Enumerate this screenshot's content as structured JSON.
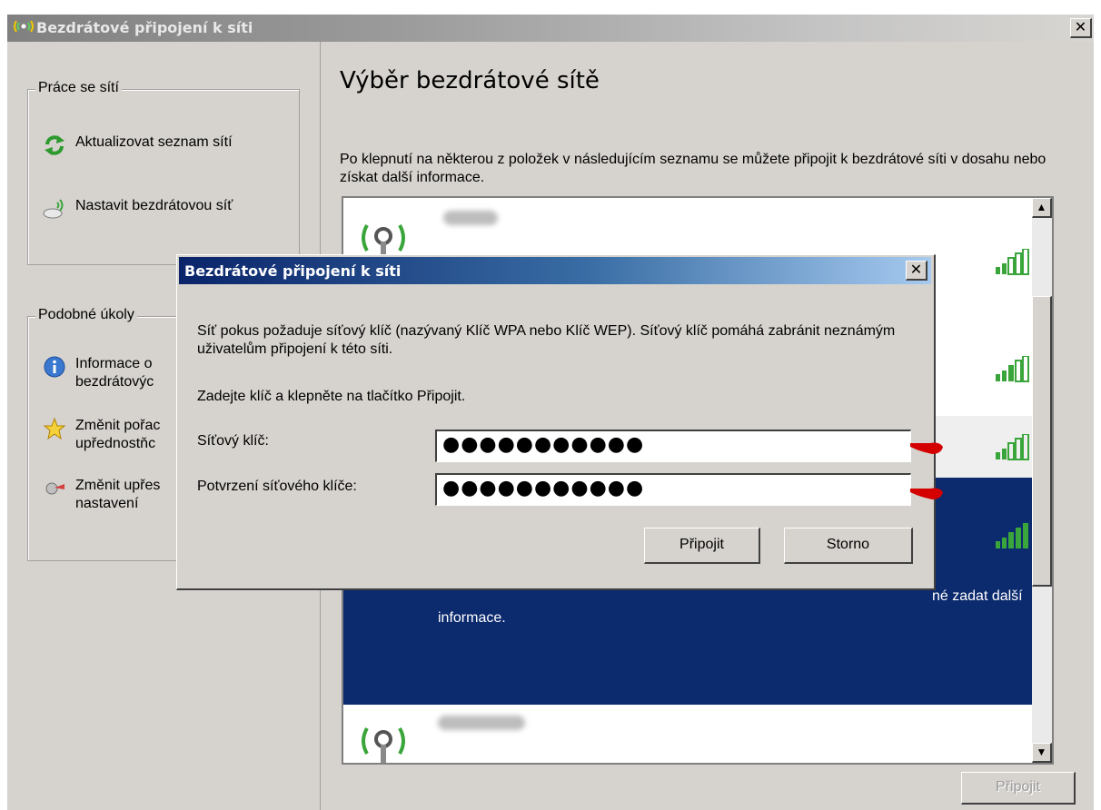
{
  "window": {
    "title": "Bezdrátové připojení k síti",
    "close_label": "✕"
  },
  "left": {
    "network_tasks": {
      "legend": "Práce se sítí",
      "items": [
        {
          "label": "Aktualizovat seznam sítí",
          "icon": "refresh-icon"
        },
        {
          "label": "Nastavit bezdrátovou síť",
          "icon": "wireless-setup-icon"
        }
      ]
    },
    "related_tasks": {
      "legend": "Podobné úkoly",
      "items": [
        {
          "label_line1": "Informace o",
          "label_line2": "bezdrátovýc",
          "icon": "info-icon"
        },
        {
          "label_line1": "Změnit pořac",
          "label_line2": "upřednostňc",
          "icon": "star-icon"
        },
        {
          "label_line1": "Změnit upřes",
          "label_line2": "nastavení",
          "icon": "settings-icon"
        }
      ]
    }
  },
  "main": {
    "heading": "Výběr bezdrátové sítě",
    "intro": "Po klepnutí na některou z položek v následujícím seznamu se můžete připojit k bezdrátové síti v dosahu nebo získat další informace.",
    "selected_text_fragment": "né zadat další",
    "selected_text_line2": "informace.",
    "connect_button": "Připojit"
  },
  "dialog": {
    "title": "Bezdrátové připojení k síti",
    "close_label": "✕",
    "message": "Síť pokus požaduje síťový klíč (nazývaný Klíč WPA nebo Klíč WEP). Síťový klíč pomáhá zabránit neznámým uživatelům připojení k této síti.",
    "instruction": "Zadejte klíč a klepněte na tlačítko Připojit.",
    "key_label": "Síťový klíč:",
    "key_value": "●●●●●●●●●●●",
    "confirm_label": "Potvrzení síťového klíče:",
    "confirm_value": "●●●●●●●●●●●",
    "connect": "Připojit",
    "cancel": "Storno"
  },
  "colors": {
    "selection": "#0c2a6e",
    "signal_green": "#3aa53a",
    "pointer_red": "#d40000"
  }
}
